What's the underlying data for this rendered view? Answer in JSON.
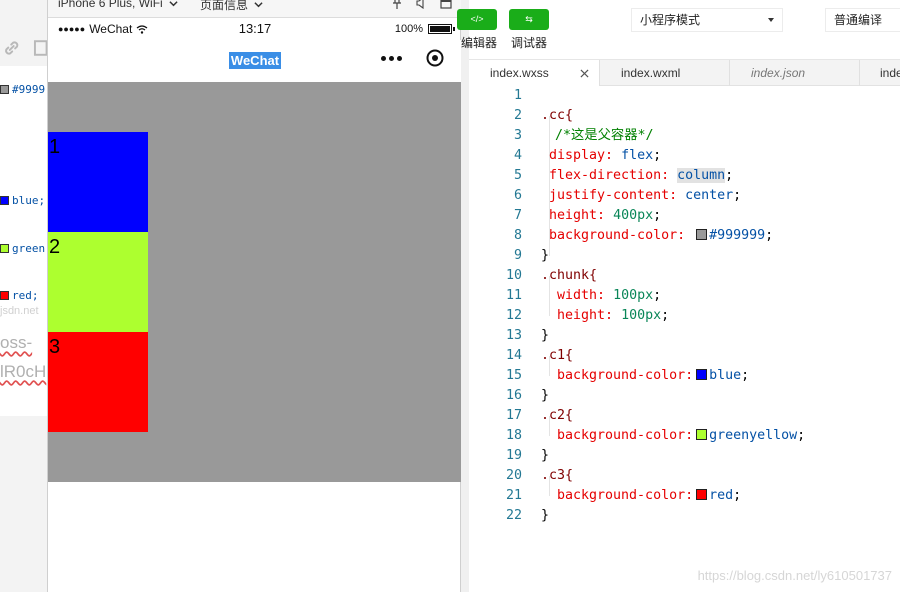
{
  "left_panel": {
    "swatch_lines": [
      {
        "text": "#9999",
        "color": "#999999"
      },
      {
        "text": "blue;",
        "color": "#0000ff"
      },
      {
        "text": "green",
        "color": "#adff2f"
      },
      {
        "text": "red;",
        "color": "#ff0000"
      }
    ],
    "faint_text": "jsdn.net",
    "gray_text_1": "oss-",
    "gray_text_2": "lR0cH"
  },
  "device_bar": {
    "device": "iPhone 6 Plus, WiFi",
    "page_info": "页面信息"
  },
  "status_bar": {
    "carrier": "WeChat",
    "time": "13:17",
    "battery": "100%"
  },
  "nav": {
    "title": "WeChat"
  },
  "preview": {
    "background": "#999999",
    "chunks": [
      {
        "label": "1",
        "color": "#0000ff"
      },
      {
        "label": "2",
        "color": "#adff2f"
      },
      {
        "label": "3",
        "color": "#ff0000"
      }
    ]
  },
  "toolbar": {
    "editor_label": "编辑器",
    "debugger_label": "调试器",
    "editor_icon": "</>",
    "debugger_icon": "⇆",
    "mode": "小程序模式",
    "compile": "普通编译",
    "accent": "#1aad19"
  },
  "tabs": [
    {
      "label": "index.wxss",
      "active": true,
      "italic": false
    },
    {
      "label": "index.wxml",
      "active": false,
      "italic": false
    },
    {
      "label": "index.json",
      "active": false,
      "italic": true
    },
    {
      "label": "index",
      "active": false,
      "italic": false
    }
  ],
  "code": {
    "line_numbers": [
      "1",
      "2",
      "3",
      "4",
      "5",
      "6",
      "7",
      "8",
      "9",
      "10",
      "11",
      "12",
      "13",
      "14",
      "15",
      "16",
      "17",
      "18",
      "19",
      "20",
      "21",
      "22"
    ],
    "l2_sel": ".cc{",
    "l3_comment": "/*这是父容器*/",
    "l4_prop": "display:",
    "l4_val": "flex",
    "l5_prop": "flex-direction:",
    "l5_val": "column",
    "l6_prop": "justify-content:",
    "l6_val": "center",
    "l7_prop": "height:",
    "l7_val": "400px",
    "l8_prop": "background-color:",
    "l8_val": "#999999",
    "l9_close": "}",
    "l10_sel": ".chunk{",
    "l11_prop": "width:",
    "l11_val": "100px",
    "l12_prop": "height:",
    "l12_val": "100px",
    "l13_close": "}",
    "l14_sel": ".c1{",
    "l15_prop": "background-color:",
    "l15_val": "blue",
    "l16_close": "}",
    "l17_sel": ".c2{",
    "l18_prop": "background-color:",
    "l18_val": "greenyellow",
    "l19_close": "}",
    "l20_sel": ".c3{",
    "l21_prop": "background-color:",
    "l21_val": "red",
    "l22_close": "}",
    "semicolon": ";"
  },
  "watermark": "https://blog.csdn.net/ly610501737"
}
